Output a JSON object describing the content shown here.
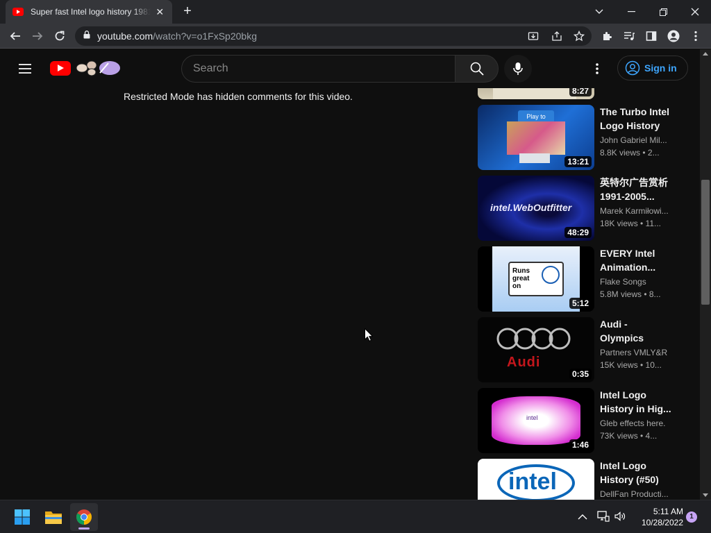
{
  "browser": {
    "tab_title": "Super fast Intel logo history 1981",
    "url_host": "youtube.com",
    "url_path": "/watch?v=o1FxSp20bkg"
  },
  "youtube": {
    "search_placeholder": "Search",
    "signin_label": "Sign in",
    "restricted_message": "Restricted Mode has hidden comments for this video.",
    "related": [
      {
        "title": "",
        "channel": "",
        "meta": "",
        "duration": "8:27"
      },
      {
        "title": "The Turbo Intel Logo History i...",
        "channel": "John Gabriel Mil...",
        "meta": "8.8K views • 2...",
        "duration": "13:21",
        "thumb_text": "Play to"
      },
      {
        "title": "英特尔广告赏析 1991-2005...",
        "channel": "Marek Karmiłowi...",
        "meta": "18K views • 11...",
        "duration": "48:29",
        "thumb_text": "intel.WebOutfitter"
      },
      {
        "title": "EVERY Intel Animation...",
        "channel": "Flake Songs",
        "meta": "5.8M views • 8...",
        "duration": "5:12",
        "thumb_text": "Runs great on"
      },
      {
        "title": "Audi - Olympics",
        "channel": "Partners VMLY&R",
        "meta": "15K views • 10...",
        "duration": "0:35",
        "thumb_text": "Audi"
      },
      {
        "title": "Intel Logo History in Hig...",
        "channel": "Gleb effects here.",
        "meta": "73K views • 4...",
        "duration": "1:46",
        "thumb_text": "intel"
      },
      {
        "title": "Intel Logo History (#50)",
        "channel": "DellFan Producti...",
        "meta": "",
        "duration": "",
        "thumb_text": "intel"
      }
    ]
  },
  "taskbar": {
    "time": "5:11 AM",
    "date": "10/28/2022",
    "notifications": "1"
  },
  "colors": {
    "accent_link": "#3ea6ff",
    "youtube_red": "#ff0000",
    "background": "#0f0f0f"
  }
}
